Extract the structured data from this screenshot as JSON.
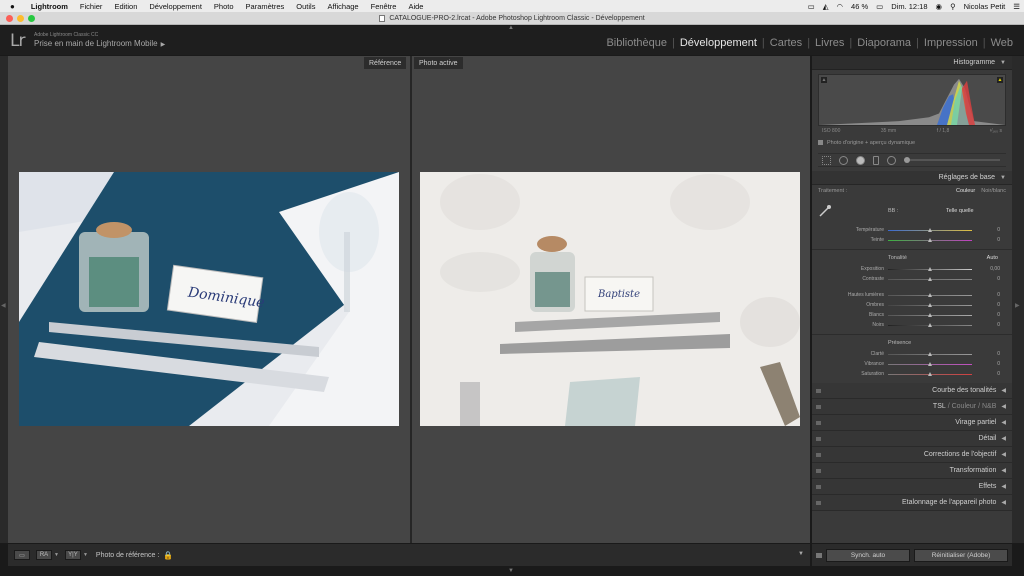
{
  "menubar": {
    "apple": "",
    "app_name": "Lightroom",
    "items": [
      "Fichier",
      "Edition",
      "Développement",
      "Photo",
      "Paramètres",
      "Outils",
      "Affichage",
      "Fenêtre",
      "Aide"
    ],
    "battery": "46 %",
    "clock": "Dim. 12:18",
    "user": "Nicolas Petit"
  },
  "titlebar": {
    "title": "CATALOGUE-PRO-2.lrcat - Adobe Photoshop Lightroom Classic - Développement"
  },
  "header": {
    "logo": "Lr",
    "subtitle": "Adobe Lightroom Classic CC",
    "identity": "Prise en main de Lightroom Mobile",
    "identity_arrow": "▶",
    "modules": [
      "Bibliothèque",
      "Développement",
      "Cartes",
      "Livres",
      "Diaporama",
      "Impression",
      "Web"
    ],
    "active_module": "Développement"
  },
  "view": {
    "reference_label": "Référence",
    "active_label": "Photo active"
  },
  "toolbar": {
    "view_button": "▭",
    "ra_button": "RA",
    "yy_button": "Y|Y",
    "reference_label": "Photo de référence :",
    "lock_icon": "🔒"
  },
  "right_panel": {
    "histogram_title": "Histogramme",
    "histo_info": {
      "iso": "ISO 800",
      "focal": "35 mm",
      "aperture": "f / 1,8",
      "shutter": "¹⁄₁₆₀ s"
    },
    "original_preview": "Photo d'origine + aperçu dynamique",
    "basic_title": "Réglages de base",
    "treatment_label": "Traitement :",
    "treatment_options": [
      "Couleur",
      "Noir/blanc"
    ],
    "wb_label": "BB :",
    "wb_value": "Telle quelle",
    "wb_sliders": [
      {
        "label": "Température",
        "value": "0"
      },
      {
        "label": "Teinte",
        "value": "0"
      }
    ],
    "tone_label": "Tonalité",
    "auto_label": "Auto",
    "tone_sliders": [
      {
        "label": "Exposition",
        "value": "0,00"
      },
      {
        "label": "Contraste",
        "value": "0"
      }
    ],
    "light_sliders": [
      {
        "label": "Hautes lumières",
        "value": "0"
      },
      {
        "label": "Ombres",
        "value": "0"
      },
      {
        "label": "Blancs",
        "value": "0"
      },
      {
        "label": "Noirs",
        "value": "0"
      }
    ],
    "presence_label": "Présence",
    "presence_sliders": [
      {
        "label": "Clarté",
        "value": "0"
      },
      {
        "label": "Vibrance",
        "value": "0"
      },
      {
        "label": "Saturation",
        "value": "0"
      }
    ],
    "panels": {
      "curve": "Courbe des tonalités",
      "tsl_1": "TSL",
      "tsl_2": "Couleur",
      "tsl_3": "N&B",
      "split": "Virage partiel",
      "detail": "Détail",
      "lens": "Corrections de l'objectif",
      "transform": "Transformation",
      "effects": "Effets",
      "calibration": "Etalonnage de l'appareil photo"
    },
    "sync_button": "Synch. auto",
    "reset_button": "Réinitialiser (Adobe)"
  },
  "photos": {
    "reference_card": "Dominique",
    "active_card": "Baptiste"
  }
}
